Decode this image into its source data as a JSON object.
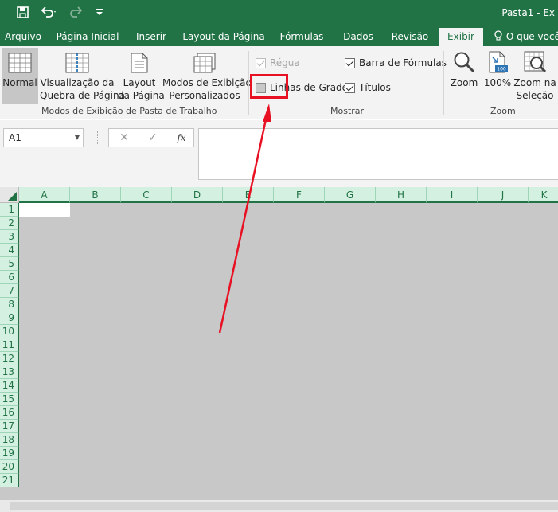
{
  "window": {
    "title": "Pasta1 - Ex"
  },
  "qat": {
    "save_icon": "save-icon",
    "undo_icon": "undo-icon",
    "redo_icon": "redo-icon",
    "customize_icon": "customize-qat-icon"
  },
  "tabs": [
    {
      "label": "Arquivo"
    },
    {
      "label": "Página Inicial"
    },
    {
      "label": "Inserir"
    },
    {
      "label": "Layout da Página"
    },
    {
      "label": "Fórmulas"
    },
    {
      "label": "Dados"
    },
    {
      "label": "Revisão"
    },
    {
      "label": "Exibir",
      "active": true
    }
  ],
  "tell_me": {
    "label": "O que você"
  },
  "ribbon": {
    "views_group": {
      "label": "Modos de Exibição de Pasta de Trabalho",
      "normal": {
        "label": "Normal"
      },
      "page_break": {
        "line1": "Visualização da",
        "line2": "Quebra de Página"
      },
      "page_layout": {
        "line1": "Layout",
        "line2": "da Página"
      },
      "custom_views": {
        "line1": "Modos de Exibição",
        "line2": "Personalizados"
      }
    },
    "show_group": {
      "label": "Mostrar",
      "ruler": {
        "label": "Régua",
        "checked": true,
        "enabled": false
      },
      "gridlines": {
        "label": "Linhas de Grade",
        "checked": false
      },
      "formula_bar": {
        "label": "Barra de Fórmulas",
        "checked": true
      },
      "headings": {
        "label": "Títulos",
        "checked": true
      }
    },
    "zoom_group": {
      "label": "Zoom",
      "zoom": {
        "label": "Zoom"
      },
      "hundred": {
        "label": "100%"
      },
      "zoom_selection": {
        "line1": "Zoom na",
        "line2": "Seleção"
      }
    }
  },
  "formula_bar": {
    "name_box": "A1",
    "cancel_symbol": "✕",
    "enter_symbol": "✓",
    "fx_symbol": "fx",
    "content": ""
  },
  "grid": {
    "columns": [
      "A",
      "B",
      "C",
      "D",
      "E",
      "F",
      "G",
      "H",
      "I",
      "J",
      "K"
    ],
    "rows": [
      "1",
      "2",
      "3",
      "4",
      "5",
      "6",
      "7",
      "8",
      "9",
      "10",
      "11",
      "12",
      "13",
      "14",
      "15",
      "16",
      "17",
      "18",
      "19",
      "20",
      "21"
    ]
  },
  "colors": {
    "excel_green": "#217346",
    "highlight_red": "#e81123",
    "grid_gray": "#c8c8c8"
  }
}
